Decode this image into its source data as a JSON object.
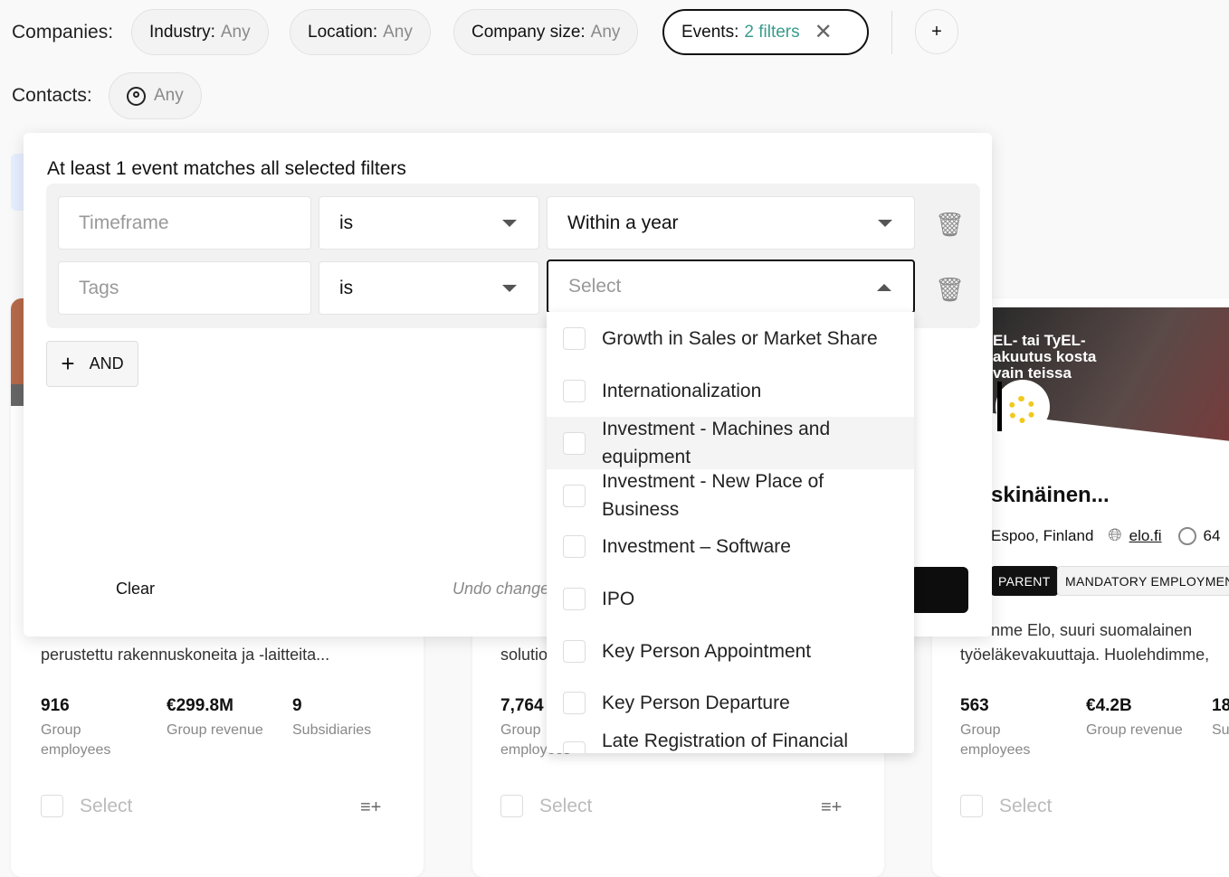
{
  "filters": {
    "companies_label": "Companies:",
    "chips": [
      {
        "key": "Industry:",
        "value": "Any"
      },
      {
        "key": "Location:",
        "value": "Any"
      },
      {
        "key": "Company size:",
        "value": "Any"
      },
      {
        "key": "Events:",
        "value": "2 filters",
        "active": true
      }
    ],
    "add_label": "+",
    "contacts_label": "Contacts:",
    "contacts_value": "Any"
  },
  "panel": {
    "title": "At least 1 event matches all selected filters",
    "rows": [
      {
        "field_placeholder": "Timeframe",
        "operator": "is",
        "value": "Within a year"
      },
      {
        "field_placeholder": "Tags",
        "operator": "is",
        "value_placeholder": "Select"
      }
    ],
    "and_label": "AND",
    "clear_label": "Clear",
    "undo_label": "Undo changes"
  },
  "tags_dropdown": {
    "options": [
      "Growth in Sales or Market Share",
      "Internationalization",
      "Investment - Machines and equipment",
      "Investment - New Place of Business",
      "Investment – Software",
      "IPO",
      "Key Person Appointment",
      "Key Person Departure",
      "Late Registration of Financial"
    ]
  },
  "cards": [
    {
      "desc": "perustettu rakennuskoneita ja -laitteita...",
      "stats": [
        {
          "value": "916",
          "label": "Group employees"
        },
        {
          "value": "€299.8M",
          "label": "Group revenue"
        },
        {
          "value": "9",
          "label": "Subsidiaries"
        }
      ],
      "select": "Select"
    },
    {
      "desc": "solutio",
      "stats": [
        {
          "value": "7,764",
          "label": "Group employees"
        }
      ],
      "select": "Select"
    },
    {
      "name": "skinäinen...",
      "location": "Espoo, Finland",
      "website": "elo.fi",
      "contacts": "64",
      "tags": [
        "PARENT",
        "MANDATORY EMPLOYMENT"
      ],
      "desc1": "nme Elo, suuri suomalainen",
      "desc2": "työeläkevakuuttaja. Huolehdimme,",
      "stats": [
        {
          "value": "563",
          "label": "Group employees"
        },
        {
          "value": "€4.2B",
          "label": "Group revenue"
        },
        {
          "value": "18",
          "label": "Su"
        }
      ],
      "select": "Select",
      "banner_text": "EL- tai TyEL- akuutus kosta vain teissa"
    }
  ]
}
